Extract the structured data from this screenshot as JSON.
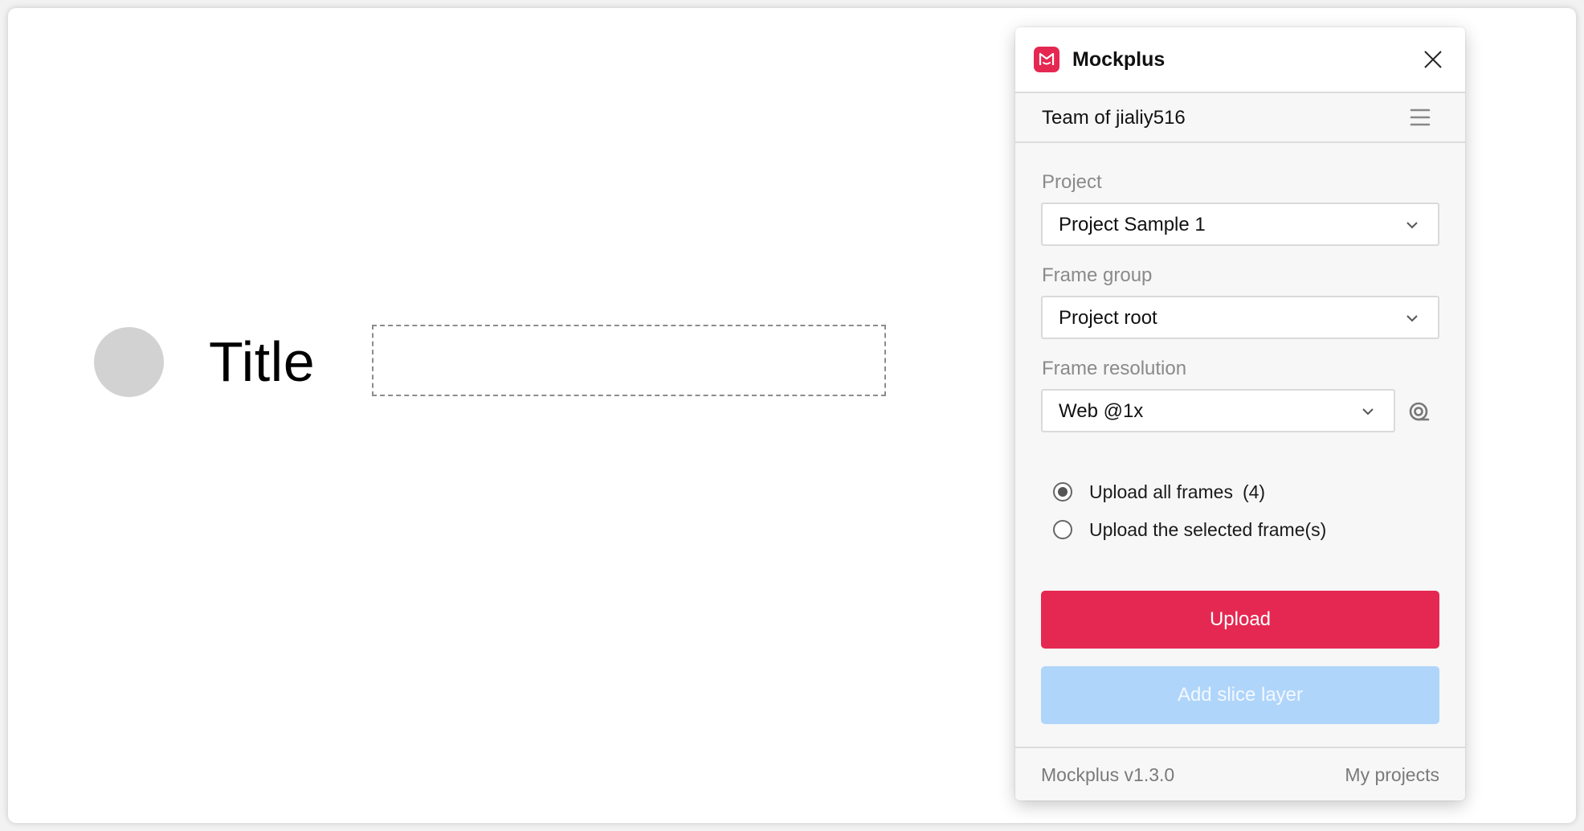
{
  "canvas": {
    "title_text": "Title"
  },
  "plugin": {
    "app_name": "Mockplus",
    "brand_color": "#e52852",
    "team_name": "Team of jialiy516",
    "fields": {
      "project": {
        "label": "Project",
        "value": "Project Sample 1"
      },
      "frame_group": {
        "label": "Frame group",
        "value": "Project root"
      },
      "frame_resolution": {
        "label": "Frame resolution",
        "value": "Web @1x"
      }
    },
    "upload_options": [
      {
        "label": "Upload all frames",
        "count": "(4)",
        "selected": true
      },
      {
        "label": "Upload the selected frame(s)",
        "count": "",
        "selected": false
      }
    ],
    "buttons": {
      "upload": "Upload",
      "add_slice": "Add slice layer"
    },
    "footer": {
      "version": "Mockplus v1.3.0",
      "my_projects": "My projects"
    },
    "icons": {
      "logo": "mockplus-logo-icon",
      "close": "close-icon",
      "menu": "hamburger-menu-icon",
      "chevron": "chevron-down-icon",
      "resolution": "resolution-settings-icon"
    }
  }
}
